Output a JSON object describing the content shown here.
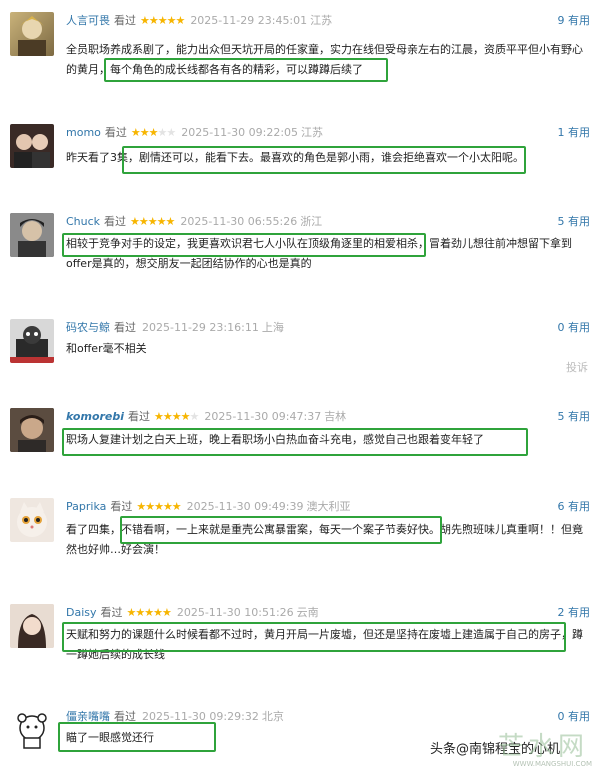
{
  "saw_label": "看过",
  "reviews": [
    {
      "user": "人言可畏",
      "stars": 5,
      "time": "2025-11-29 23:45:01",
      "loc": "江苏",
      "useful": "9 有用",
      "text": "全员职场养成系剧了，能力出众但天坑开局的任家童，实力在线但受母亲左右的江晨，资质平平但小有野心的黄月，每个角色的成长线都各有各的精彩，可以蹲蹲后续了"
    },
    {
      "user": "momo",
      "stars": 3,
      "time": "2025-11-30 09:22:05",
      "loc": "江苏",
      "useful": "1 有用",
      "text": "昨天看了3集，剧情还可以，能看下去。最喜欢的角色是郭小雨，谁会拒绝喜欢一个小太阳呢。"
    },
    {
      "user": "Chuck",
      "stars": 5,
      "time": "2025-11-30 06:55:26",
      "loc": "浙江",
      "useful": "5 有用",
      "text": "相较于竞争对手的设定，我更喜欢识君七人小队在顶级角逐里的相爱相杀，冒着劲儿想往前冲想留下拿到offer是真的，想交朋友一起团结协作的心也是真的"
    },
    {
      "user": "码农与鲸",
      "stars": 0,
      "time": "2025-11-29 23:16:11",
      "loc": "上海",
      "useful": "0 有用",
      "text": "和offer毫不相关",
      "report": "投诉"
    },
    {
      "user": "komorebi",
      "stars": 4,
      "time": "2025-11-30 09:47:37",
      "loc": "吉林",
      "useful": "5 有用",
      "text": "职场人复建计划之白天上班，晚上看职场小白热血奋斗充电，感觉自己也跟着变年轻了"
    },
    {
      "user": "Paprika",
      "stars": 5,
      "time": "2025-11-30 09:49:39",
      "loc": "澳大利亚",
      "useful": "6 有用",
      "text": "看了四集，不错看啊，一上来就是重壳公寓暴雷案，每天一个案子节奏好快。胡先煦班味儿真重啊！！但竟然也好帅…好会演！"
    },
    {
      "user": "Daisy",
      "stars": 5,
      "time": "2025-11-30 10:51:26",
      "loc": "云南",
      "useful": "2 有用",
      "text": "天赋和努力的课题什么时候看都不过时，黄月开局一片废墟，但还是坚持在废墟上建造属于自己的房子，蹲一蹲她后续的成长线"
    },
    {
      "user": "僵亲嘴嘴",
      "stars": 0,
      "time": "2025-11-30 09:29:32",
      "loc": "北京",
      "useful": "0 有用",
      "text": "瞄了一眼感觉还行"
    }
  ],
  "watermark": {
    "logo": "芒水网",
    "sub": "WWW.MANGSHUI.COM",
    "toutiao": "头条@南锦程宝的心机"
  },
  "colors": {
    "accent": "#37a",
    "highlight": "#2fa33b",
    "star": "#f7b500"
  }
}
